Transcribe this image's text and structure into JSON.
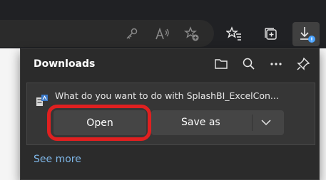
{
  "browser": {
    "icons": [
      "key-icon",
      "read-aloud-icon",
      "add-favorite-icon",
      "favorites-icon",
      "collections-icon",
      "downloads-icon"
    ]
  },
  "downloads": {
    "title": "Downloads",
    "header_icons": [
      "folder-icon",
      "search-icon",
      "more-icon",
      "pin-icon"
    ],
    "item": {
      "prompt": "What do you want to do with SplashBI_ExcelCon...",
      "open_label": "Open",
      "save_as_label": "Save as"
    },
    "see_more": "See more"
  },
  "colors": {
    "highlight": "#e02020",
    "link": "#7fb7e8",
    "badge": "#4aa3ff"
  }
}
